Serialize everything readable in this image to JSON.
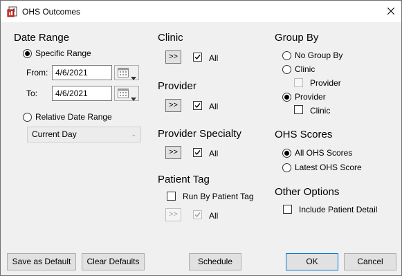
{
  "window": {
    "title": "OHS Outcomes",
    "icon": "report-app-icon",
    "close_icon": "close-icon"
  },
  "date_range": {
    "heading": "Date Range",
    "specific_label": "Specific Range",
    "from_label": "From:",
    "from_value": "4/6/2021",
    "to_label": "To:",
    "to_value": "4/6/2021",
    "relative_label": "Relative Date Range",
    "relative_value": "Current Day",
    "selected": "specific"
  },
  "clinic": {
    "heading": "Clinic",
    "button": ">>",
    "all_label": "All",
    "all_checked": true
  },
  "provider": {
    "heading": "Provider",
    "button": ">>",
    "all_label": "All",
    "all_checked": true
  },
  "provider_specialty": {
    "heading": "Provider Specialty",
    "button": ">>",
    "all_label": "All",
    "all_checked": true
  },
  "patient_tag": {
    "heading": "Patient Tag",
    "run_by_label": "Run By Patient Tag",
    "run_by_checked": false,
    "button": ">>",
    "all_label": "All",
    "all_checked": true
  },
  "group_by": {
    "heading": "Group By",
    "no_group_label": "No Group By",
    "clinic_label": "Clinic",
    "clinic_sub_provider_label": "Provider",
    "provider_label": "Provider",
    "provider_sub_clinic_label": "Clinic",
    "selected": "provider"
  },
  "ohs_scores": {
    "heading": "OHS Scores",
    "all_label": "All OHS Scores",
    "latest_label": "Latest OHS Score",
    "selected": "all"
  },
  "other_options": {
    "heading": "Other Options",
    "include_detail_label": "Include Patient Detail",
    "include_detail_checked": false
  },
  "buttons": {
    "save_default": "Save as Default",
    "clear_defaults": "Clear Defaults",
    "schedule": "Schedule",
    "ok": "OK",
    "cancel": "Cancel"
  },
  "colors": {
    "accent": "#0078d7",
    "background": "#f0f0f0",
    "titlebar": "#ffffff"
  }
}
